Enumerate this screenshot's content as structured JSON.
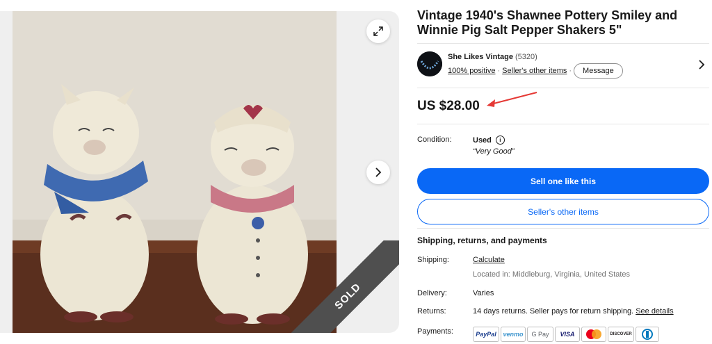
{
  "item": {
    "title": "Vintage 1940's Shawnee Pottery Smiley and Winnie Pig Salt Pepper Shakers 5\"",
    "price": "US $28.00",
    "sold_ribbon": "SOLD"
  },
  "seller": {
    "name": "She Likes Vintage",
    "feedback_count": "(5320)",
    "positive": "100% positive",
    "other_items_link": "Seller's other items",
    "message_label": "Message"
  },
  "condition": {
    "label": "Condition:",
    "value": "Used",
    "quote": "“Very Good”"
  },
  "buttons": {
    "primary": "Sell one like this",
    "secondary": "Seller's other items"
  },
  "shipping_section": {
    "title": "Shipping, returns, and payments",
    "shipping_label": "Shipping:",
    "shipping_value": "Calculate",
    "location": "Located in: Middleburg, Virginia, United States",
    "delivery_label": "Delivery:",
    "delivery_value": "Varies",
    "returns_label": "Returns:",
    "returns_value": "14 days returns. Seller pays for return shipping.",
    "returns_link": "See details",
    "payments_label": "Payments:"
  },
  "payments": [
    "PayPal",
    "venmo",
    "G Pay",
    "VISA",
    "mastercard",
    "DISCOVER",
    "diners"
  ],
  "colors": {
    "accent": "#0968f6",
    "ribbon": "#4f4f4f",
    "arrow": "#e53935"
  }
}
